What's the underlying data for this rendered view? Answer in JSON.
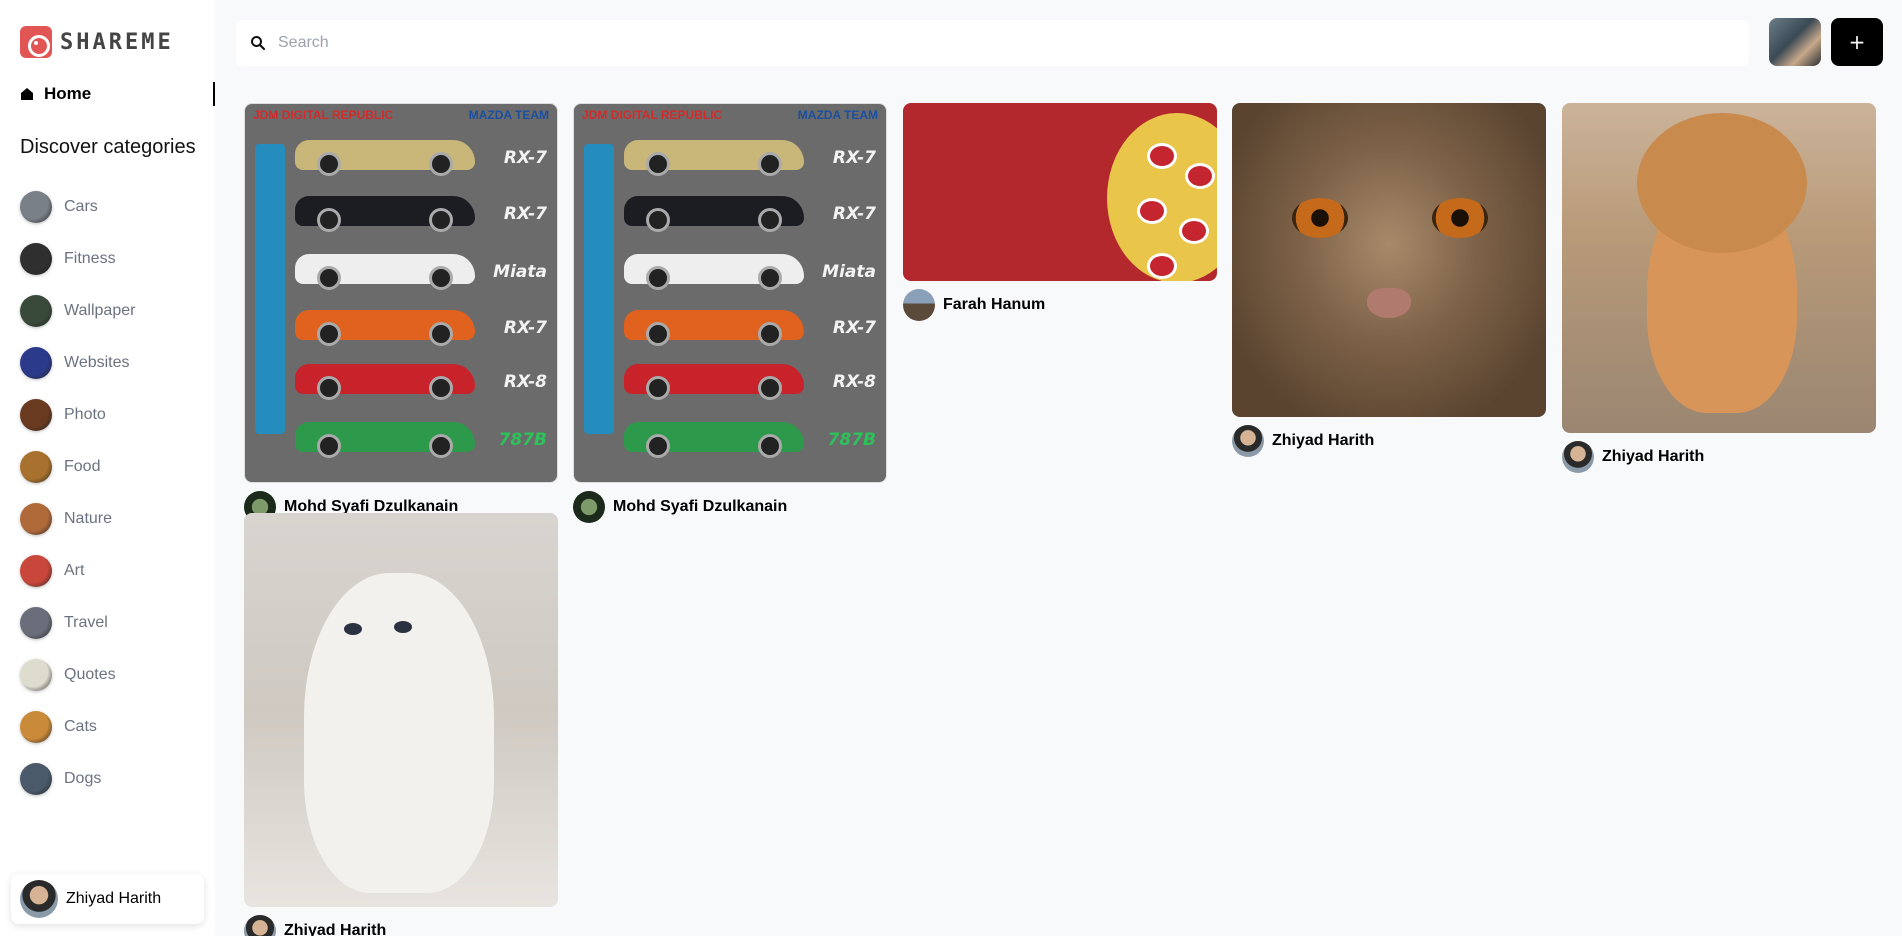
{
  "app": {
    "logo_text": "SHAREME"
  },
  "sidebar": {
    "home_label": "Home",
    "discover_heading": "Discover categories",
    "categories": [
      {
        "label": "Cars",
        "color": "#7a8088"
      },
      {
        "label": "Fitness",
        "color": "#2f2f2f"
      },
      {
        "label": "Wallpaper",
        "color": "#3a4a3a"
      },
      {
        "label": "Websites",
        "color": "#2b3a8a"
      },
      {
        "label": "Photo",
        "color": "#6a3a20"
      },
      {
        "label": "Food",
        "color": "#a8722e"
      },
      {
        "label": "Nature",
        "color": "#b06a3a"
      },
      {
        "label": "Art",
        "color": "#c9473a"
      },
      {
        "label": "Travel",
        "color": "#6a6e7a"
      },
      {
        "label": "Quotes",
        "color": "#dedbcf"
      },
      {
        "label": "Cats",
        "color": "#c98a3a"
      },
      {
        "label": "Dogs",
        "color": "#4a5a6a"
      }
    ],
    "user_name": "Zhiyad Harith"
  },
  "search": {
    "placeholder": "Search"
  },
  "header": {
    "add_label": "+"
  },
  "pins": [
    {
      "author": "Mohd Syafi Dzulkanain",
      "mazda_left": "JDM DIGITAL REPUBLIC",
      "mazda_right": "MAZDA TEAM",
      "car_names": [
        "RX-7",
        "RX-7",
        "Miata",
        "RX-7",
        "RX-8",
        "787B"
      ]
    },
    {
      "author": "Mohd Syafi Dzulkanain",
      "mazda_left": "JDM DIGITAL REPUBLIC",
      "mazda_right": "MAZDA TEAM",
      "car_names": [
        "RX-7",
        "RX-7",
        "Miata",
        "RX-7",
        "RX-8",
        "787B"
      ]
    },
    {
      "author": "Farah Hanum"
    },
    {
      "author": "Zhiyad Harith"
    },
    {
      "author": "Zhiyad Harith"
    },
    {
      "author": "Zhiyad Harith"
    }
  ]
}
